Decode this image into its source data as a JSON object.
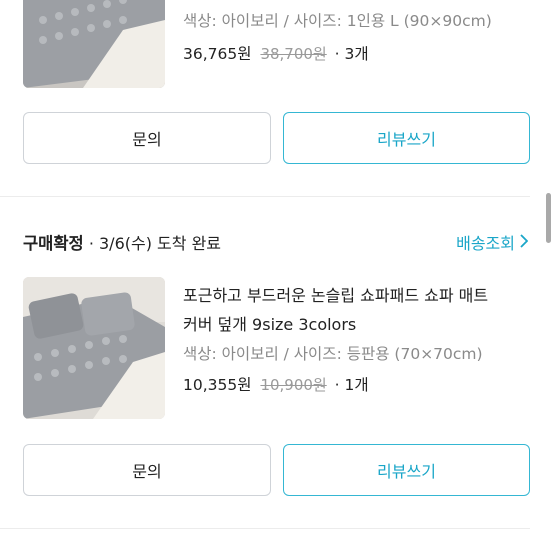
{
  "item1": {
    "option": "색상: 아이보리 / 사이즈: 1인용 L (90×90cm)",
    "price": "36,765원",
    "old_price": "38,700원",
    "qty": "· 3개",
    "inquiry_label": "문의",
    "review_label": "리뷰쓰기"
  },
  "order2": {
    "status": "구매확정",
    "status_detail": "· 3/6(수) 도착 완료",
    "track_label": "배송조회",
    "track_icon": "chevron-right-icon"
  },
  "item2": {
    "title_line1": "포근하고 부드러운 논슬립 쇼파패드 쇼파 매트",
    "title_line2": "커버 덮개 9size 3colors",
    "option": "색상: 아이보리 / 사이즈: 등판용 (70×70cm)",
    "price": "10,355원",
    "old_price": "10,900원",
    "qty": "· 1개",
    "inquiry_label": "문의",
    "review_label": "리뷰쓰기"
  },
  "colors": {
    "accent": "#1aa6c8",
    "accent_border": "#35b7d3",
    "muted_text": "#8a8a8a",
    "divider": "#ececec"
  }
}
